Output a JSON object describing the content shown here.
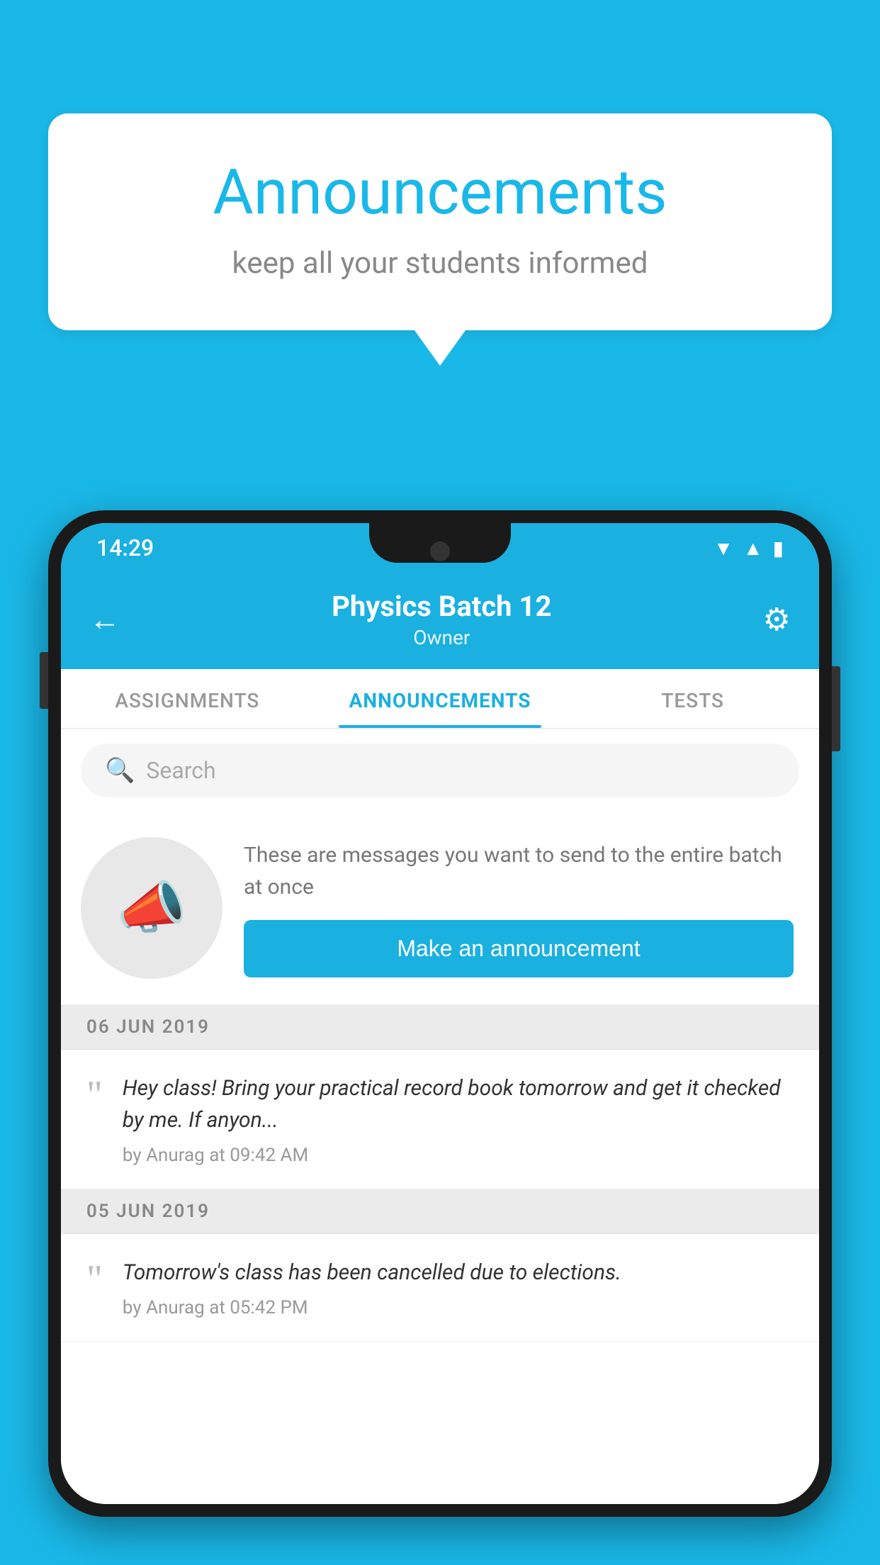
{
  "background_color": "#1ab8e8",
  "bubble": {
    "title": "Announcements",
    "subtitle": "keep all your students informed"
  },
  "phone": {
    "status_bar": {
      "time": "14:29"
    },
    "header": {
      "title": "Physics Batch 12",
      "subtitle": "Owner",
      "back_label": "←",
      "gear_label": "⚙"
    },
    "tabs": [
      {
        "label": "ASSIGNMENTS",
        "active": false
      },
      {
        "label": "ANNOUNCEMENTS",
        "active": true
      },
      {
        "label": "TESTS",
        "active": false
      }
    ],
    "search": {
      "placeholder": "Search"
    },
    "promo": {
      "description": "These are messages you want to send to the entire batch at once",
      "button_label": "Make an announcement"
    },
    "announcements": [
      {
        "date": "06  JUN  2019",
        "text": "Hey class! Bring your practical record book tomorrow and get it checked by me. If anyon...",
        "meta": "by Anurag at 09:42 AM"
      },
      {
        "date": "05  JUN  2019",
        "text": "Tomorrow's class has been cancelled due to elections.",
        "meta": "by Anurag at 05:42 PM"
      }
    ]
  }
}
